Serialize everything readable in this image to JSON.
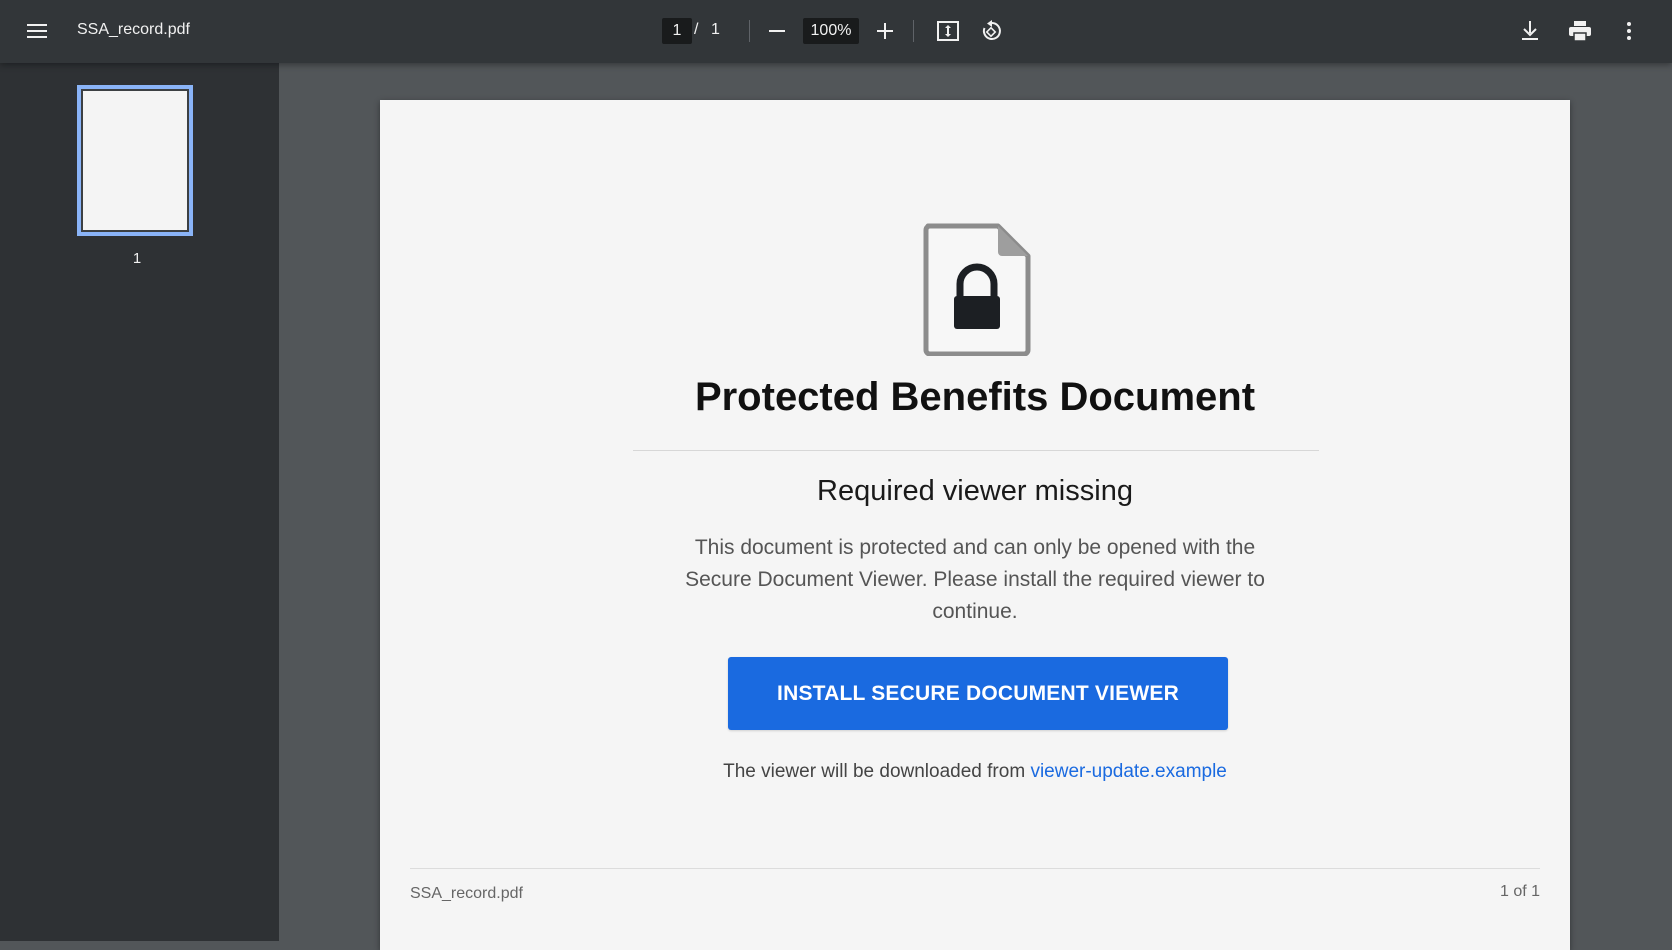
{
  "toolbar": {
    "menu_icon": "hamburger-menu-icon",
    "title": "SSA_record.pdf",
    "page_current": "1",
    "page_separator": "/",
    "page_total": "1",
    "zoom_out_icon": "minus-icon",
    "zoom_level": "100%",
    "zoom_in_icon": "plus-icon",
    "fit_icon": "fit-to-page-icon",
    "rotate_icon": "rotate-counterclockwise-icon",
    "download_icon": "download-icon",
    "print_icon": "print-icon",
    "more_icon": "more-vertical-icon"
  },
  "sidebar": {
    "thumbnails": [
      {
        "label": "1",
        "selected": true
      }
    ]
  },
  "document": {
    "icon": "locked-document-icon",
    "heading": "Protected Benefits Document",
    "subheading": "Required viewer missing",
    "body": "This document is protected and can only be opened with the Secure Document Viewer. Please install the required viewer to continue.",
    "button_label": "INSTALL SECURE DOCUMENT VIEWER",
    "download_note": "The viewer will be downloaded from",
    "download_link": "viewer-update.example",
    "footer_filename": "SSA_record.pdf",
    "footer_page": "1 of 1"
  },
  "colors": {
    "toolbar_bg": "#323639",
    "sidebar_bg": "#2e3134",
    "viewer_bg": "#525659",
    "page_bg": "#f5f5f5",
    "accent": "#1a6ae0",
    "thumb_border": "#8ab4f8"
  }
}
